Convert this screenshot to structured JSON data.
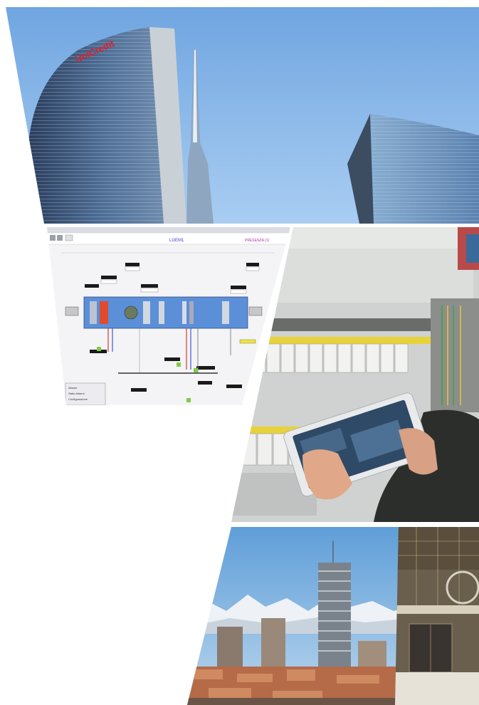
{
  "collage": {
    "tower_brand": "UniCredit",
    "scada": {
      "title": "LGEM1",
      "corner_label": "PRESENZA (1)",
      "legend_rows": [
        "Allarmi",
        "Stato Allarmi",
        "Configurazione"
      ]
    }
  },
  "colors": {
    "sky": "#7fb0e6",
    "scada_blue": "#5b8fd8",
    "cabinet_grey": "#d8dad8",
    "terminal_yellow": "#e8d23a",
    "roof_terracotta": "#b56a48"
  }
}
